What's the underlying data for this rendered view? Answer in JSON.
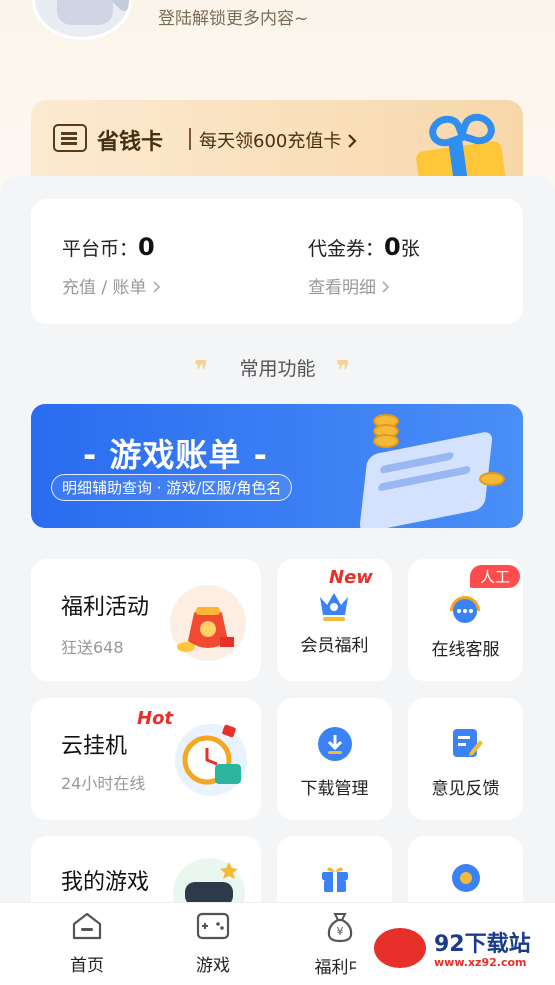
{
  "profile": {
    "login_hint": "登陆解锁更多内容~"
  },
  "saver": {
    "title": "省钱卡",
    "subtitle": "每天领600充值卡"
  },
  "wallet": {
    "coins_label": "平台币：",
    "coins_value": "0",
    "coins_link": "充值 / 账单",
    "voucher_label": "代金券：",
    "voucher_value": "0",
    "voucher_unit": "张",
    "voucher_link": "查看明细"
  },
  "section": {
    "title": "常用功能"
  },
  "banner": {
    "title": "- 游戏账单 -",
    "subtitle": "明细辅助查询 · 游戏/区服/角色名"
  },
  "features": {
    "welfare": {
      "title": "福利活动",
      "subtitle": "狂送648"
    },
    "cloud": {
      "title": "云挂机",
      "subtitle": "24小时在线",
      "tag": "Hot"
    },
    "mygames": {
      "title": "我的游戏"
    },
    "vip": {
      "label": "会员福利",
      "tag": "New"
    },
    "service": {
      "label": "在线客服",
      "tag": "人工"
    },
    "download": {
      "label": "下载管理"
    },
    "feedback": {
      "label": "意见反馈"
    }
  },
  "tabs": [
    {
      "label": "首页"
    },
    {
      "label": "游戏"
    },
    {
      "label": "福利中"
    }
  ],
  "watermark": {
    "text": "92下载站",
    "url": "www.xz92.com"
  },
  "colors": {
    "accent": "#2f6fee",
    "brand_red": "#e8302a",
    "gold": "#f5b93a"
  },
  "icons": [
    "saver-card-icon",
    "gift-icon",
    "crown-icon",
    "headset-icon",
    "download-icon",
    "edit-icon",
    "gift-box-icon",
    "gear-icon",
    "home-icon",
    "gamepad-icon",
    "money-bag-icon"
  ]
}
